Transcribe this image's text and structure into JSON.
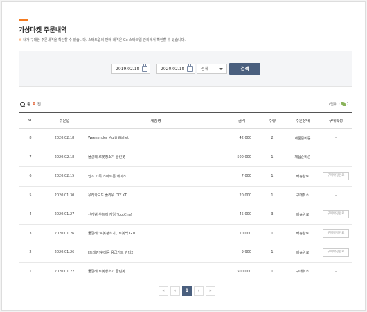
{
  "page": {
    "title": "가상마켓 주문내역",
    "notice": "내가 구매한 주문내역을 확인할 수 있습니다. 스타트업의 판매 내역은 Go 스타트업 관리에서 확인할 수 있습니다."
  },
  "filter": {
    "start_date": "2019.02.18",
    "separator": "~",
    "end_date": "2020.02.18",
    "status_select": "전체",
    "search_label": "검색"
  },
  "summary": {
    "total_prefix": "총",
    "total_count": "8",
    "total_suffix": "건",
    "unit_label": "(단위 :"
  },
  "table": {
    "headers": [
      "NO",
      "주문일",
      "제품명",
      "금액",
      "수량",
      "주문상태",
      "구매확정"
    ],
    "rows": [
      {
        "no": "8",
        "date": "2020.02.18",
        "product": "Weekender Multi Wallet",
        "price": "42,000",
        "qty": "2",
        "status": "제품준비중",
        "confirm": "-"
      },
      {
        "no": "7",
        "date": "2020.02.18",
        "product": "물걸레 로봇청소기 클린봇",
        "price": "500,000",
        "qty": "1",
        "status": "제품준비중",
        "confirm": "-"
      },
      {
        "no": "6",
        "date": "2020.02.15",
        "product": "인조 가죽 스마트폰 케이스",
        "price": "7,000",
        "qty": "1",
        "status": "배송완료",
        "confirm": "구매확정완료"
      },
      {
        "no": "5",
        "date": "2020.01.30",
        "product": "우리카보드 플라워 DIY KT",
        "price": "20,000",
        "qty": "1",
        "status": "구매취소",
        "confirm": "-"
      },
      {
        "no": "4",
        "date": "2020.01.27",
        "product": "신개념 웃놀이 게임 YootCha!",
        "price": "45,000",
        "qty": "3",
        "status": "배송완료",
        "confirm": "구매확정완료"
      },
      {
        "no": "3",
        "date": "2020.01.26",
        "product": "물걸레 '로봇청소기', 로봇백 G10",
        "price": "10,000",
        "qty": "1",
        "status": "배송완료",
        "confirm": "구매확정완료"
      },
      {
        "no": "2",
        "date": "2020.01.26",
        "product": "[트래킹]휴대용 응급키트 반디2",
        "price": "9,900",
        "qty": "1",
        "status": "배송완료",
        "confirm": "구매확정완료"
      },
      {
        "no": "1",
        "date": "2020.01.22",
        "product": "물걸레 로봇청소기 클린봇",
        "price": "500,000",
        "qty": "1",
        "status": "구매취소",
        "confirm": "-"
      }
    ]
  },
  "pagination": {
    "first": "«",
    "prev": "‹",
    "current": "1",
    "next": "›",
    "last": "»"
  },
  "colors": {
    "accent": "#f47b20",
    "primary_button": "#4a5f7e",
    "count_highlight": "#e05a2b"
  }
}
